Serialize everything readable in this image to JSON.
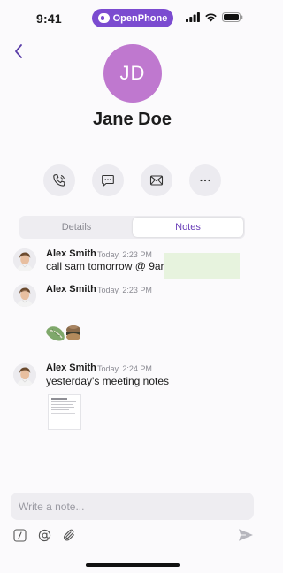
{
  "status_bar": {
    "time": "9:41",
    "brand": "OpenPhone"
  },
  "contact": {
    "initials": "JD",
    "name": "Jane Doe",
    "avatar_color": "#bf78cf"
  },
  "actions": [
    {
      "name": "call",
      "icon": "phone-icon"
    },
    {
      "name": "message",
      "icon": "message-icon"
    },
    {
      "name": "email",
      "icon": "mail-icon"
    },
    {
      "name": "more",
      "icon": "more-icon"
    }
  ],
  "tabs": {
    "details": "Details",
    "notes": "Notes",
    "active": "notes"
  },
  "notes": [
    {
      "author": "Alex Smith",
      "time": "Today, 2:23 PM",
      "text_prefix": "call sam ",
      "mention": "tomorrow @ 9ar"
    },
    {
      "author": "Alex Smith",
      "time": "Today, 2:23 PM",
      "text": "",
      "attachment": "stickers"
    },
    {
      "author": "Alex Smith",
      "time": "Today, 2:24 PM",
      "text": "yesterday's meeting notes",
      "attachment": "document"
    }
  ],
  "composer": {
    "placeholder": "Write a note..."
  },
  "colors": {
    "accent": "#7b4bd0",
    "notes_tab_text": "#6a3fb8",
    "highlight": "#e7f3de"
  }
}
